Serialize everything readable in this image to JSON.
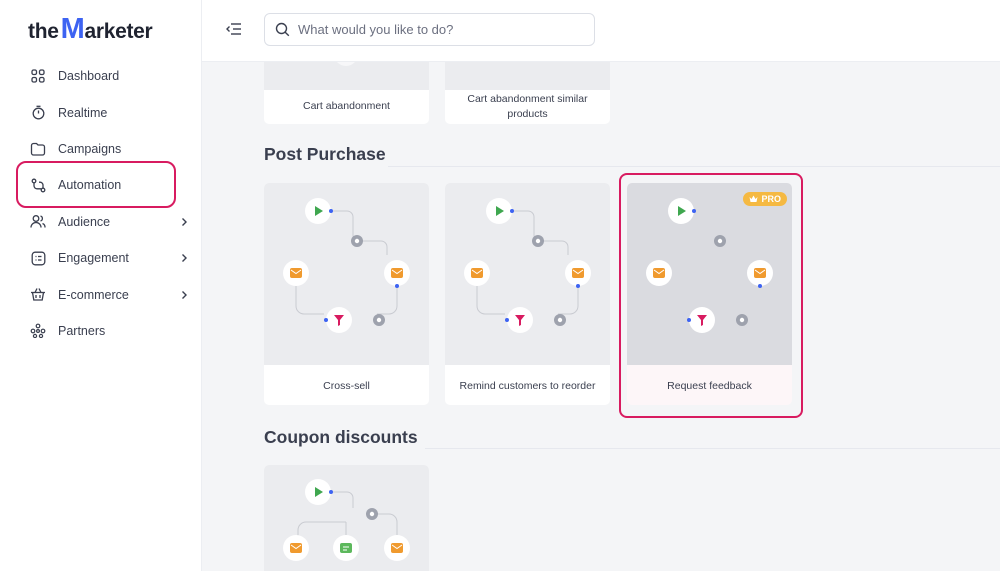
{
  "brand": {
    "prefix": "the",
    "initial": "M",
    "suffix": "arketer"
  },
  "search": {
    "placeholder": "What would you like to do?"
  },
  "sidebar": {
    "items": [
      {
        "label": "Dashboard",
        "icon": "grid-icon",
        "has_chevron": false
      },
      {
        "label": "Realtime",
        "icon": "stopwatch-icon",
        "has_chevron": false
      },
      {
        "label": "Campaigns",
        "icon": "folder-icon",
        "has_chevron": false
      },
      {
        "label": "Automation",
        "icon": "workflow-icon",
        "has_chevron": false,
        "active": true
      },
      {
        "label": "Audience",
        "icon": "users-icon",
        "has_chevron": true
      },
      {
        "label": "Engagement",
        "icon": "chat-list-icon",
        "has_chevron": true
      },
      {
        "label": "E-commerce",
        "icon": "basket-icon",
        "has_chevron": true
      },
      {
        "label": "Partners",
        "icon": "partners-icon",
        "has_chevron": false
      }
    ]
  },
  "sections": {
    "top_cards": [
      {
        "label": "Cart abandonment"
      },
      {
        "label": "Cart abandonment similar products"
      }
    ],
    "post_purchase": {
      "title": "Post Purchase",
      "cards": [
        {
          "label": "Cross-sell",
          "pro": false
        },
        {
          "label": "Remind customers to reorder",
          "pro": false
        },
        {
          "label": "Request feedback",
          "pro": true,
          "badge": "PRO"
        }
      ]
    },
    "coupon_discounts": {
      "title": "Coupon discounts"
    }
  },
  "colors": {
    "accent": "#d81b60",
    "brand_blue": "#3d63f2",
    "pro_badge": "#f5b942",
    "start_node": "#3fa74f",
    "email_node": "#f09a2e",
    "filter_node": "#d81b60",
    "sms_node": "#5cb85c"
  }
}
